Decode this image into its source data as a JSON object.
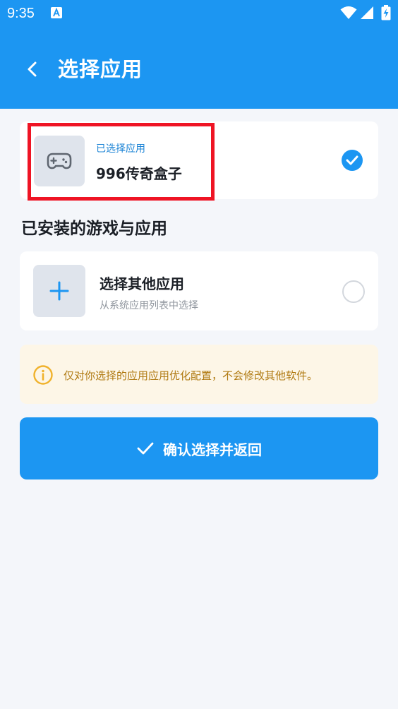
{
  "status_bar": {
    "time": "9:35"
  },
  "header": {
    "title": "选择应用"
  },
  "selected_app": {
    "caption": "已选择应用",
    "name": "996传奇盒子"
  },
  "installed_section": {
    "title": "已安装的游戏与应用"
  },
  "other_app": {
    "title": "选择其他应用",
    "subtitle": "从系统应用列表中选择"
  },
  "notice": {
    "text": "仅对你选择的应用应用优化配置，不会修改其他软件。"
  },
  "confirm": {
    "label": "确认选择并返回"
  },
  "colors": {
    "primary": "#1c96f2",
    "highlight": "#ef1424",
    "notice_bg": "#fdf6e7",
    "notice_text": "#b07a12"
  },
  "icons": {
    "back": "chevron-left-icon",
    "app_tile": "gamepad-icon",
    "selected_check": "check-circle-icon",
    "other_tile": "plus-icon",
    "notice": "info-icon",
    "confirm": "checkmark-icon"
  }
}
